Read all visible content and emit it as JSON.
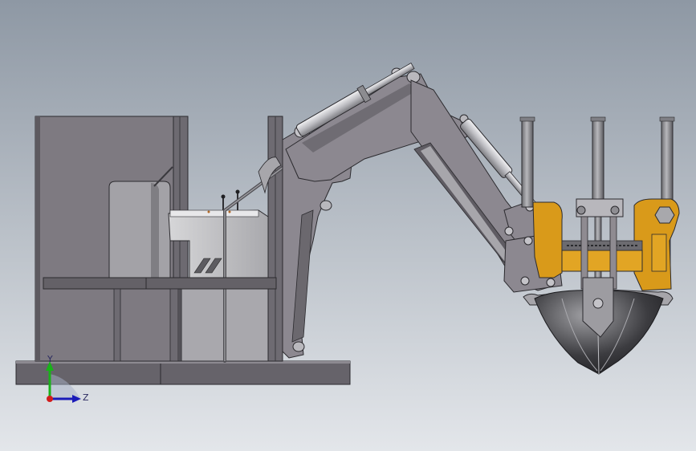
{
  "triad": {
    "y_label": "Y",
    "z_label": "Z",
    "y_color": "#19b219",
    "z_color": "#1a1ab8",
    "x_color": "#d21c1c"
  },
  "colors": {
    "bg_top": "#8e98a4",
    "bg_bottom": "#e3e6ea",
    "steel": "#8f8b91",
    "steel_dark": "#5e5b60",
    "orange": "#d99a1a",
    "silver": "#c9c9cc"
  }
}
